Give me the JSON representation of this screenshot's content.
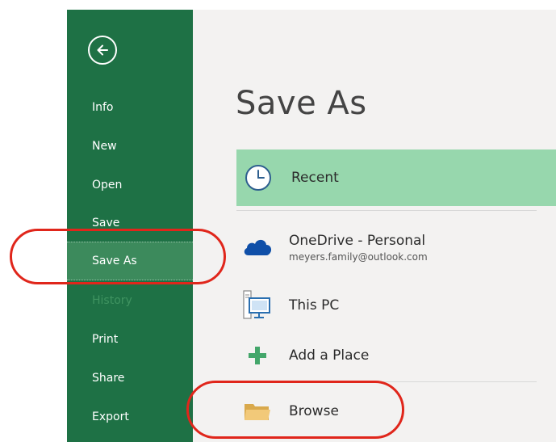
{
  "sidebar": {
    "items": [
      {
        "label": "Info",
        "state": "normal"
      },
      {
        "label": "New",
        "state": "normal"
      },
      {
        "label": "Open",
        "state": "normal"
      },
      {
        "label": "Save",
        "state": "normal"
      },
      {
        "label": "Save As",
        "state": "selected"
      },
      {
        "label": "History",
        "state": "disabled"
      },
      {
        "label": "Print",
        "state": "normal"
      },
      {
        "label": "Share",
        "state": "normal"
      },
      {
        "label": "Export",
        "state": "normal"
      }
    ]
  },
  "main": {
    "title": "Save As",
    "places": [
      {
        "label": "Recent",
        "icon": "clock-icon",
        "selected": true
      },
      {
        "label": "OneDrive - Personal",
        "sublabel": "meyers.family@outlook.com",
        "icon": "onedrive-cloud-icon"
      },
      {
        "label": "This PC",
        "icon": "computer-icon"
      },
      {
        "label": "Add a Place",
        "icon": "plus-icon"
      },
      {
        "label": "Browse",
        "icon": "folder-icon"
      }
    ]
  },
  "colors": {
    "sidebar_green": "#1e7145",
    "selected_place": "#97d7ad",
    "annotation_red": "#e0261b"
  }
}
